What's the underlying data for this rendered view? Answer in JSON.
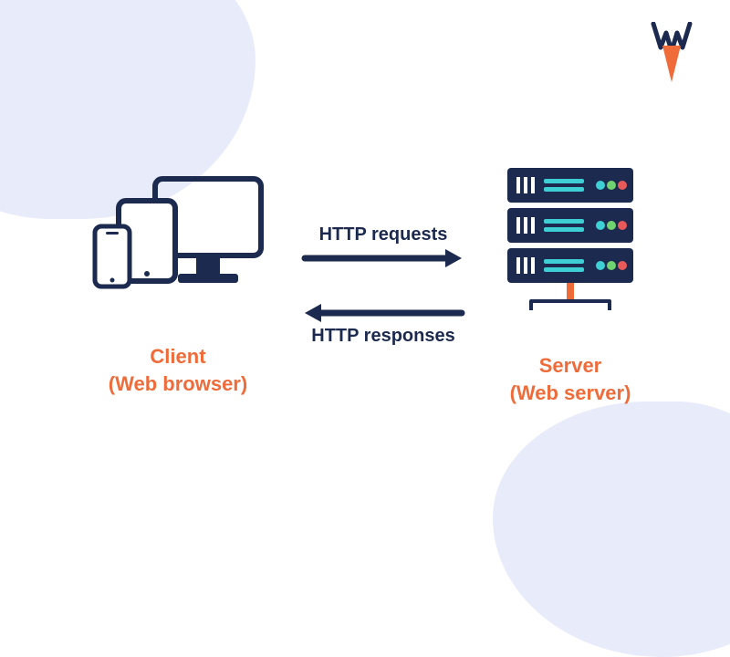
{
  "logo": {
    "letter": "W"
  },
  "client": {
    "title": "Client",
    "subtitle": "(Web browser)"
  },
  "server": {
    "title": "Server",
    "subtitle": "(Web server)"
  },
  "arrows": {
    "request_label": "HTTP requests",
    "response_label": "HTTP responses"
  },
  "colors": {
    "navy": "#1b2a4e",
    "orange": "#ef6c3a",
    "blob": "#e8ebf9",
    "teal": "#3ecfd4",
    "green": "#6fd36f",
    "red": "#e85a5a"
  }
}
